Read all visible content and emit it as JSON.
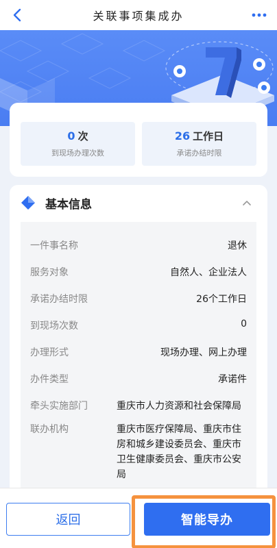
{
  "nav": {
    "title": "关联事项集成办",
    "back_icon": "chevron-left-icon",
    "more_icon": "more-horizontal-icon"
  },
  "colors": {
    "primary": "#2f6ef0",
    "banner": "#5a8cf7",
    "highlight": "#f5923e",
    "stat_bg": "#eef3fb"
  },
  "stats": [
    {
      "number": "0",
      "unit": "次",
      "label": "到现场办理次数"
    },
    {
      "number": "26",
      "unit": "工作日",
      "label": "承诺办结时限"
    }
  ],
  "info": {
    "title": "基本信息",
    "rows": [
      {
        "label": "一件事名称",
        "value": "退休"
      },
      {
        "label": "服务对象",
        "value": "自然人、企业法人"
      },
      {
        "label": "承诺办结时限",
        "value": "26个工作日"
      },
      {
        "label": "到现场次数",
        "value": "0"
      },
      {
        "label": "办理形式",
        "value": "现场办理、网上办理"
      },
      {
        "label": "办件类型",
        "value": "承诺件"
      },
      {
        "label": "牵头实施部门",
        "value": "重庆市人力资源和社会保障局"
      },
      {
        "label": "联办机构",
        "value": "重庆市医疗保障局、重庆市住房和城乡建设委员会、重庆市卫生健康委员会、重庆市公安局"
      }
    ]
  },
  "bottom": {
    "back_label": "返回",
    "guide_label": "智能导办"
  }
}
